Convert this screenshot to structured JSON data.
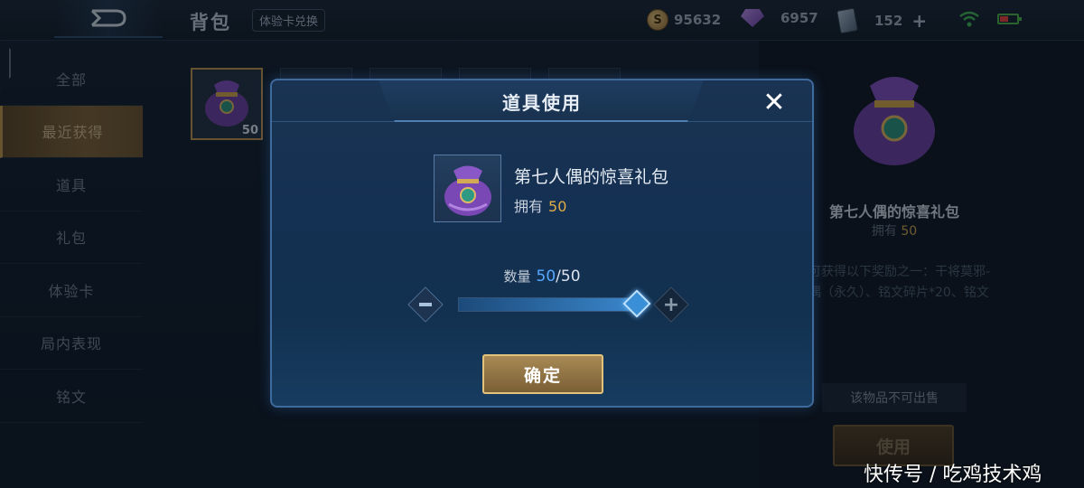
{
  "header": {
    "title": "背包",
    "exchange_label": "体验卡兑换",
    "gold": "95632",
    "gems": "6957",
    "vouchers": "152",
    "back_icon": "back-arrow-icon",
    "gold_icon": "gold-coin-icon",
    "gem_icon": "diamond-icon",
    "voucher_icon": "voucher-icon",
    "add_icon": "plus-icon"
  },
  "sidebar": {
    "items": [
      {
        "label": "全部"
      },
      {
        "label": "最近获得"
      },
      {
        "label": "道具"
      },
      {
        "label": "礼包"
      },
      {
        "label": "体验卡"
      },
      {
        "label": "局内表现"
      },
      {
        "label": "铭文"
      }
    ],
    "active_index": 1
  },
  "grid": {
    "selected_count": "50"
  },
  "detail": {
    "name": "第七人偶的惊喜礼包",
    "owned_label": "拥有",
    "owned_value": "50",
    "desc_line1": "可获得以下奖励之一：干将莫邪-",
    "desc_line2": "偶（永久）、铭文碎片*20、铭文",
    "not_sellable": "该物品不可出售",
    "use_label": "使用"
  },
  "modal": {
    "title": "道具使用",
    "item_name": "第七人偶的惊喜礼包",
    "owned_label": "拥有",
    "owned_value": "50",
    "qty_label": "数量",
    "qty_current": "50",
    "qty_separator": "/",
    "qty_max": "50",
    "slider_fraction": 1.0,
    "confirm_label": "确定",
    "close_icon": "close-icon",
    "minus_icon": "minus-icon",
    "plus_icon": "plus-icon"
  },
  "watermark": "快传号 / 吃鸡技术鸡",
  "colors": {
    "accent_blue": "#58a8ff",
    "gold_text": "#e0ac48",
    "confirm_border": "#e3c27c"
  }
}
